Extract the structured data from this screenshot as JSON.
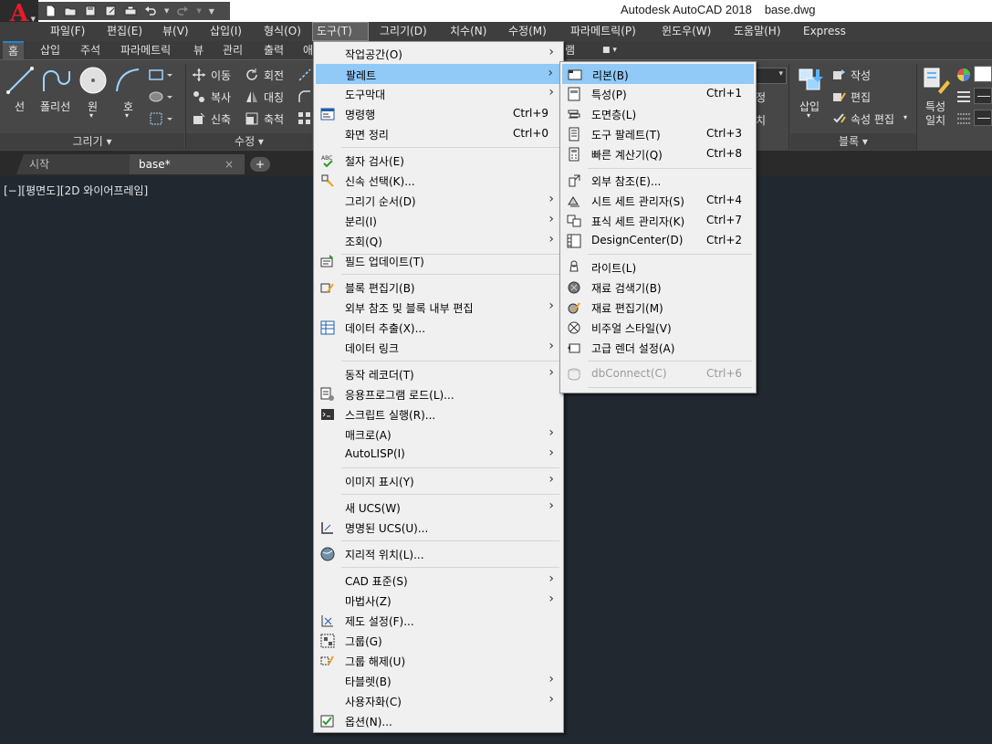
{
  "title": {
    "app": "Autodesk AutoCAD 2018",
    "file": "base.dwg"
  },
  "app_logo": "A",
  "menubar": [
    "파일(F)",
    "편집(E)",
    "뷰(V)",
    "삽입(I)",
    "형식(O)",
    "도구(T)",
    "그리기(D)",
    "치수(N)",
    "수정(M)",
    "파라메트릭(P)",
    "윈도우(W)",
    "도움말(H)",
    "Express"
  ],
  "ribbon_tabs": [
    "홈",
    "삽입",
    "주석",
    "파라메트릭",
    "뷰",
    "관리",
    "출력",
    "애",
    "램"
  ],
  "ribbon": {
    "draw": {
      "line": "선",
      "polyline": "폴리선",
      "circle": "원",
      "arc": "호",
      "title": "그리기 ▾"
    },
    "modify": {
      "move": "이동",
      "rotate": "회전",
      "copy": "복사",
      "mirror": "대칭",
      "stretch": "신축",
      "scale": "축척",
      "title": "수정 ▾"
    },
    "insert": "삽입",
    "block": {
      "create": "작성",
      "edit": "편집",
      "attr_edit": "속성 편집",
      "title": "블록 ▾"
    },
    "match_props_1": "특성",
    "match_props_2": "일치",
    "partial_1": "정",
    "partial_2": "치"
  },
  "doc_tabs": {
    "start": "시작",
    "base": "base*",
    "close": "×",
    "new": "+"
  },
  "viewport_label": "[−][평면도][2D 와이어프레임]",
  "tools_menu": [
    {
      "label": "작업공간(O)",
      "sub": true
    },
    {
      "label": "팔레트",
      "sub": true,
      "highlight": true
    },
    {
      "label": "도구막대",
      "sub": true
    },
    {
      "label": "명령행",
      "shortcut": "Ctrl+9",
      "icon": "command-line-icon"
    },
    {
      "label": "화면 정리",
      "shortcut": "Ctrl+0"
    },
    {
      "label": "철자 검사(E)",
      "icon": "spell-check-icon"
    },
    {
      "label": "신속 선택(K)...",
      "icon": "quick-select-icon"
    },
    {
      "label": "그리기 순서(D)",
      "sub": true
    },
    {
      "label": "분리(I)",
      "sub": true
    },
    {
      "label": "조회(Q)",
      "sub": true
    },
    {
      "label": "필드 업데이트(T)",
      "icon": "update-field-icon"
    },
    {
      "label": "블록 편집기(B)",
      "icon": "block-editor-icon"
    },
    {
      "label": "외부 참조 및 블록 내부 편집",
      "sub": true
    },
    {
      "label": "데이터 추출(X)...",
      "icon": "data-extraction-icon"
    },
    {
      "label": "데이터 링크",
      "sub": true
    },
    {
      "label": "동작 레코더(T)",
      "sub": true
    },
    {
      "label": "응용프로그램 로드(L)...",
      "icon": "load-app-icon"
    },
    {
      "label": "스크립트 실행(R)...",
      "icon": "script-icon"
    },
    {
      "label": "매크로(A)",
      "sub": true
    },
    {
      "label": "AutoLISP(I)",
      "sub": true
    },
    {
      "label": "이미지 표시(Y)",
      "sub": true
    },
    {
      "label": "새 UCS(W)",
      "sub": true
    },
    {
      "label": "명명된 UCS(U)...",
      "icon": "named-ucs-icon"
    },
    {
      "label": "지리적 위치(L)...",
      "icon": "globe-icon"
    },
    {
      "label": "CAD 표준(S)",
      "sub": true
    },
    {
      "label": "마법사(Z)",
      "sub": true
    },
    {
      "label": "제도 설정(F)...",
      "icon": "drafting-settings-icon"
    },
    {
      "label": "그룹(G)",
      "icon": "group-icon"
    },
    {
      "label": "그룹 해제(U)",
      "icon": "ungroup-icon"
    },
    {
      "label": "타블렛(B)",
      "sub": true
    },
    {
      "label": "사용자화(C)",
      "sub": true
    },
    {
      "label": "옵션(N)...",
      "icon": "options-check-icon"
    }
  ],
  "palettes_menu": [
    {
      "label": "리본(B)",
      "icon": "ribbon-icon",
      "highlight": true
    },
    {
      "label": "특성(P)",
      "shortcut": "Ctrl+1",
      "icon": "properties-icon"
    },
    {
      "label": "도면층(L)",
      "icon": "layers-icon"
    },
    {
      "label": "도구 팔레트(T)",
      "shortcut": "Ctrl+3",
      "icon": "tool-palettes-icon"
    },
    {
      "label": "빠른 계산기(Q)",
      "shortcut": "Ctrl+8",
      "icon": "calculator-icon"
    },
    {
      "label": "외부 참조(E)...",
      "icon": "xref-icon"
    },
    {
      "label": "시트 세트 관리자(S)",
      "shortcut": "Ctrl+4",
      "icon": "sheet-set-icon"
    },
    {
      "label": "표식 세트 관리자(K)",
      "shortcut": "Ctrl+7",
      "icon": "markup-set-icon"
    },
    {
      "label": "DesignCenter(D)",
      "shortcut": "Ctrl+2",
      "icon": "design-center-icon"
    },
    {
      "label": "라이트(L)",
      "icon": "lights-icon"
    },
    {
      "label": "재료 검색기(B)",
      "icon": "materials-browser-icon"
    },
    {
      "label": "재료 편집기(M)",
      "icon": "materials-editor-icon"
    },
    {
      "label": "비주얼 스타일(V)",
      "icon": "visual-styles-icon"
    },
    {
      "label": "고급 렌더 설정(A)",
      "icon": "render-settings-icon"
    },
    {
      "label": "dbConnect(C)",
      "shortcut": "Ctrl+6",
      "icon": "dbconnect-icon",
      "disabled": true
    }
  ]
}
